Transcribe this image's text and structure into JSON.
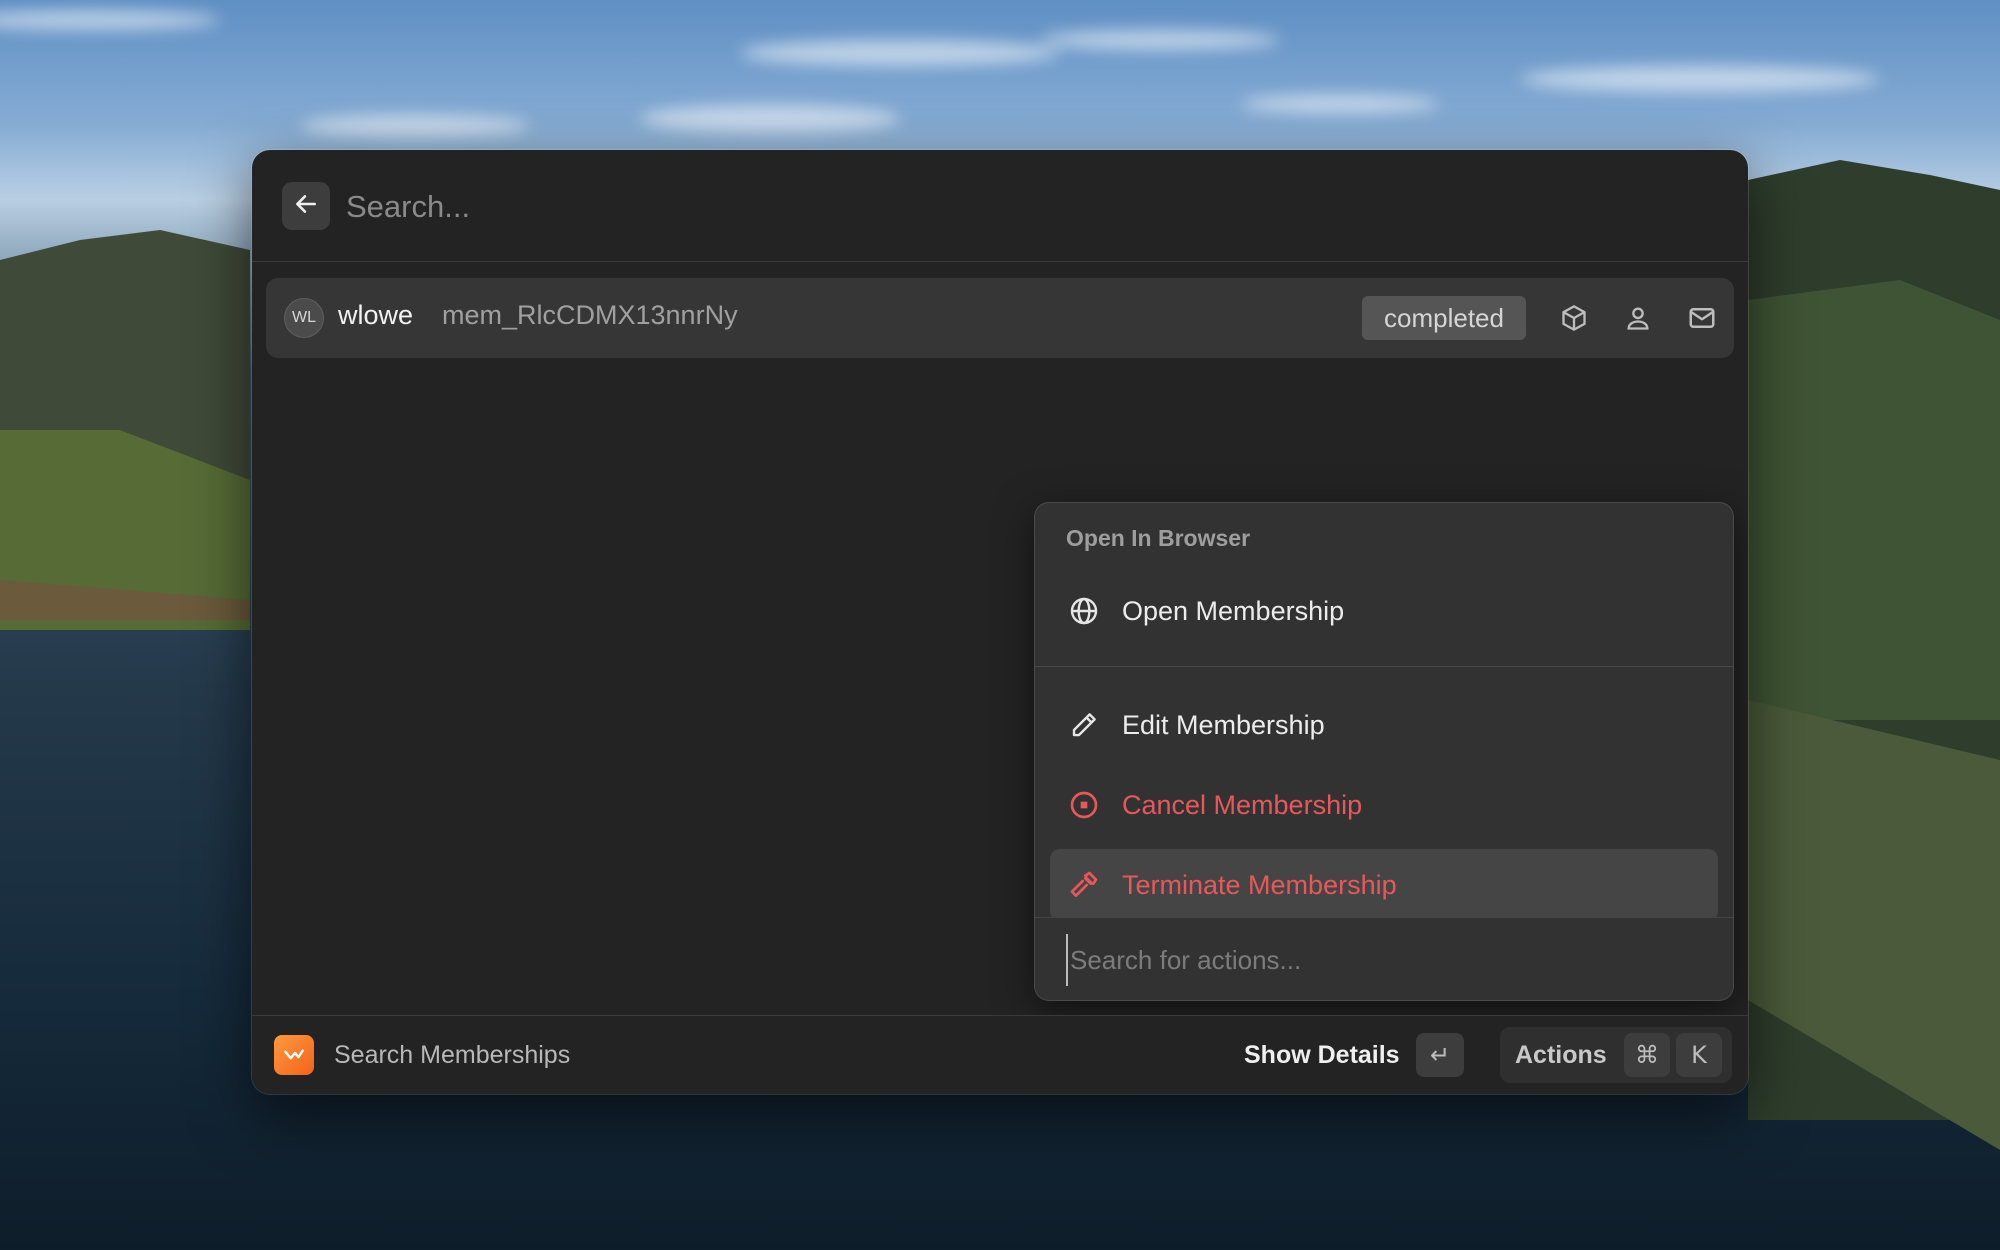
{
  "search": {
    "placeholder": "Search..."
  },
  "list": {
    "item": {
      "avatar_initials": "WL",
      "title": "wlowe",
      "subtitle": "mem_RlcCDMX13nnrNy",
      "status_badge": "completed"
    }
  },
  "action_panel": {
    "section_title": "Open In Browser",
    "items": [
      {
        "label": "Open Membership",
        "icon": "globe-icon"
      },
      {
        "label": "Edit Membership",
        "icon": "pencil-icon"
      },
      {
        "label": "Cancel Membership",
        "icon": "stop-circle-icon"
      },
      {
        "label": "Terminate Membership",
        "icon": "hammer-icon"
      }
    ],
    "search_placeholder": "Search for actions..."
  },
  "footer": {
    "title": "Search Memberships",
    "primary_action": "Show Details",
    "primary_shortcut": "↵",
    "actions_label": "Actions",
    "actions_shortcut": [
      "⌘",
      "K"
    ]
  },
  "colors": {
    "window_bg": "#232323",
    "panel_bg": "#323232",
    "danger": "#e8585a",
    "extension_orange": "#f2631c"
  }
}
